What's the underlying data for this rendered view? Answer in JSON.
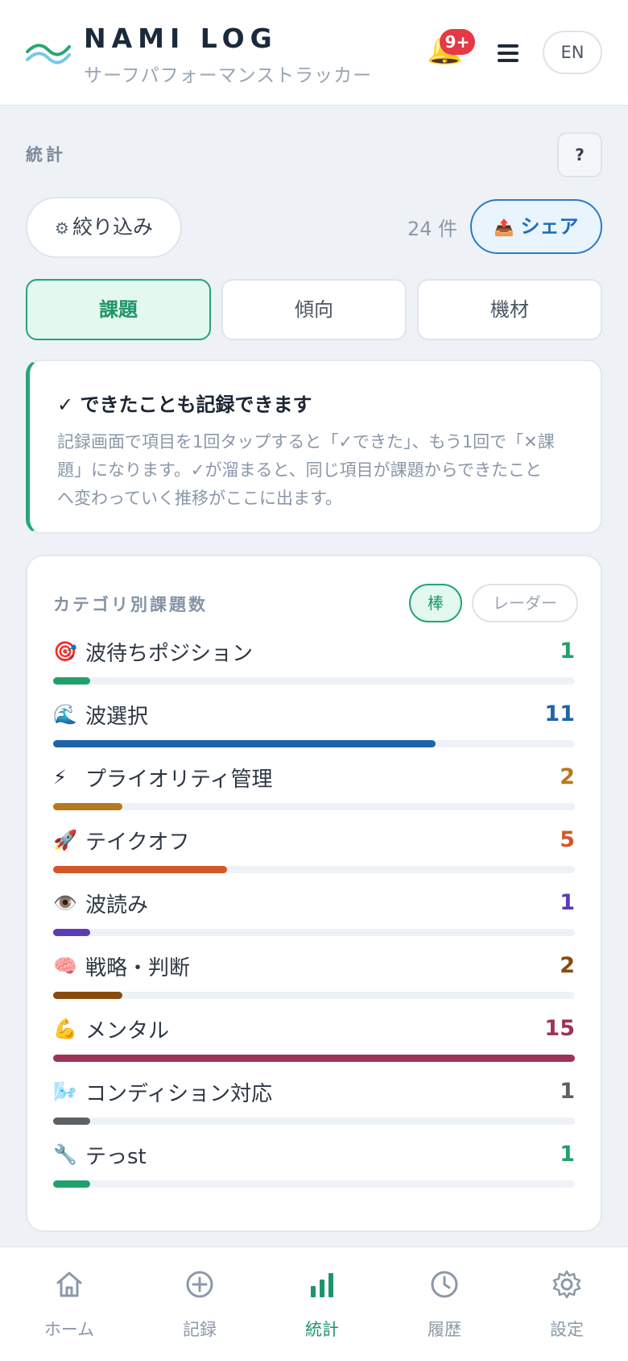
{
  "header": {
    "title": "NAMI LOG",
    "subtitle": "サーフパフォーマンストラッカー",
    "badge": "9+",
    "lang": "EN"
  },
  "section": {
    "label": "統計",
    "help": "?"
  },
  "filter": {
    "label": "絞り込み",
    "count": "24 件",
    "share": "シェア"
  },
  "tabs": [
    {
      "label": "課題",
      "active": true
    },
    {
      "label": "傾向",
      "active": false
    },
    {
      "label": "機材",
      "active": false
    }
  ],
  "info": {
    "title": "✓ できたことも記録できます",
    "body_lines": [
      "記録画面で項目を1回タップすると「✓できた」、もう1回で「✕課",
      "題」になります。✓が溜まると、同じ項目が課題からできたこと",
      "へ変わっていく推移がここに出ます。"
    ]
  },
  "categories": {
    "title": "カテゴリ別課題数",
    "view_bar": "棒",
    "view_radar": "レーダー",
    "max": 15,
    "items": [
      {
        "icon": "🎯",
        "icon_name": "target-icon",
        "label": "波待ちポジション",
        "value": 1,
        "color": "#22a06b"
      },
      {
        "icon": "🌊",
        "icon_name": "wave-icon",
        "label": "波選択",
        "value": 11,
        "color": "#1f64a8"
      },
      {
        "icon": "⚡",
        "icon_name": "lightning-icon",
        "label": "プライオリティ管理",
        "value": 2,
        "color": "#b7791f"
      },
      {
        "icon": "🚀",
        "icon_name": "rocket-icon",
        "label": "テイクオフ",
        "value": 5,
        "color": "#d4572a"
      },
      {
        "icon": "👁️",
        "icon_name": "eye-icon",
        "label": "波読み",
        "value": 1,
        "color": "#5b3cb5"
      },
      {
        "icon": "🧠",
        "icon_name": "brain-icon",
        "label": "戦略・判断",
        "value": 2,
        "color": "#8a4b0f"
      },
      {
        "icon": "💪",
        "icon_name": "muscle-icon",
        "label": "メンタル",
        "value": 15,
        "color": "#9e3358"
      },
      {
        "icon": "🌬️",
        "icon_name": "wind-icon",
        "label": "コンディション対応",
        "value": 1,
        "color": "#5d6166"
      },
      {
        "icon": "🔧",
        "icon_name": "wrench-icon",
        "label": "テっst",
        "value": 1,
        "color": "#22a06b"
      }
    ]
  },
  "nav": [
    {
      "label": "ホーム",
      "icon": "home-icon",
      "active": false
    },
    {
      "label": "記録",
      "icon": "plus-circle-icon",
      "active": false
    },
    {
      "label": "統計",
      "icon": "bar-chart-icon",
      "active": true
    },
    {
      "label": "履歴",
      "icon": "clock-icon",
      "active": false
    },
    {
      "label": "設定",
      "icon": "gear-icon",
      "active": false
    }
  ]
}
